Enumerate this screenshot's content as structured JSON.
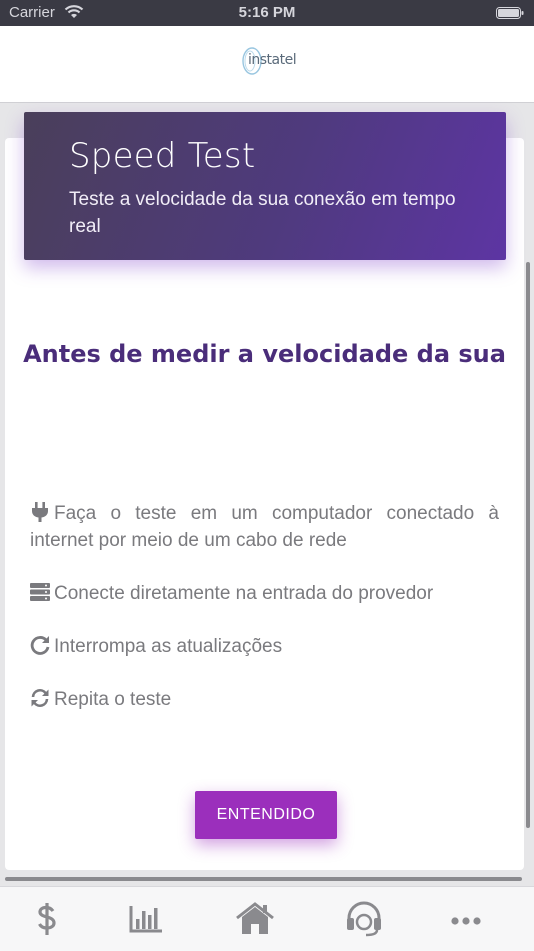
{
  "status_bar": {
    "carrier": "Carrier",
    "time": "5:16 PM"
  },
  "header": {
    "logo_text": "instatel"
  },
  "hero": {
    "title": "Speed Test",
    "subtitle": "Teste a velocidade da sua conexão em tempo real"
  },
  "content": {
    "heading": "Antes de medir a velocidade da sua",
    "tips": [
      {
        "icon": "plug-icon",
        "text": "Faça o teste em um computador conectado à internet por meio de um cabo de rede"
      },
      {
        "icon": "server-icon",
        "text": "Conecte diretamente na entrada do provedor"
      },
      {
        "icon": "refresh-icon",
        "text": "Interrompa as atualizações"
      },
      {
        "icon": "sync-icon",
        "text": "Repita o teste"
      }
    ],
    "button_label": "ENTENDIDO"
  },
  "tabbar": {
    "items": [
      {
        "icon": "dollar-icon"
      },
      {
        "icon": "bar-chart-icon"
      },
      {
        "icon": "home-icon"
      },
      {
        "icon": "headset-icon"
      },
      {
        "icon": "more-icon"
      }
    ]
  },
  "colors": {
    "accent": "#9b2fbc",
    "heading": "#4a2d7a",
    "hero_start": "#4a3f5a",
    "hero_end": "#5d35a3",
    "icon": "#7a7a7e"
  }
}
